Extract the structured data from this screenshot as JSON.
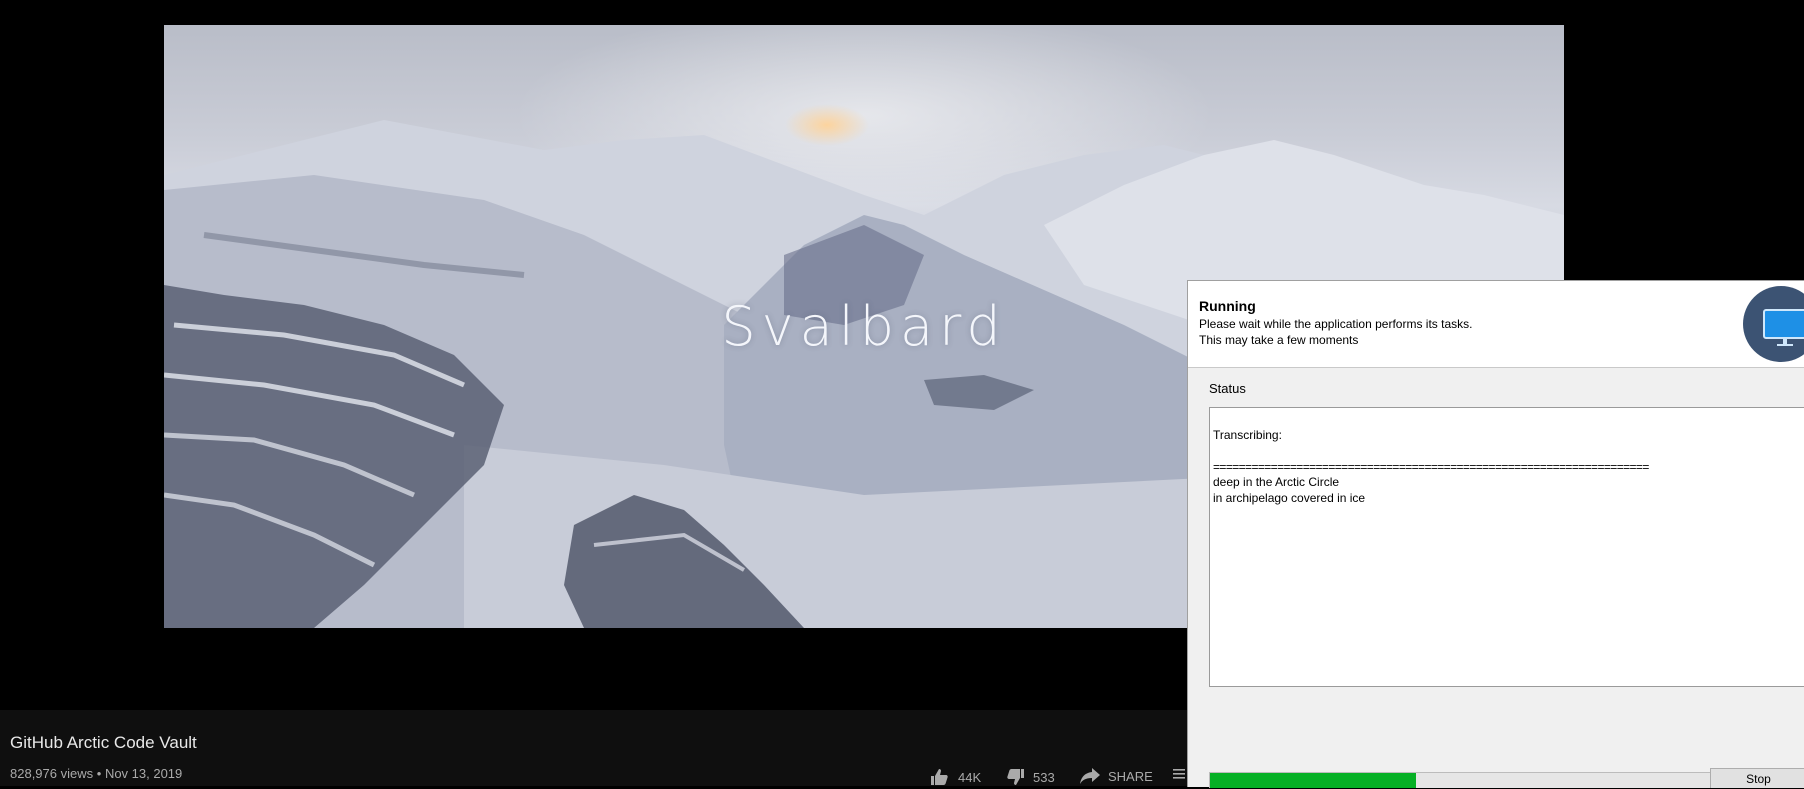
{
  "video": {
    "overlay_title": "Svalbard",
    "name": "GitHub Arctic Code Vault",
    "views": "828,976 views",
    "separator": "•",
    "date": "Nov 13, 2019",
    "likes": "44K",
    "dislikes": "533",
    "share_label": "SHARE"
  },
  "dialog": {
    "heading": "Running",
    "subtitle_line1": "Please wait while the application performs its tasks.",
    "subtitle_line2": "This may take a few moments",
    "status_label": "Status",
    "status_lines": [
      "Transcribing:",
      "====================================================================",
      "deep in the Arctic Circle",
      "in archipelago covered in ice"
    ],
    "progress_fraction": 0.41,
    "stop_label": "Stop"
  },
  "colors": {
    "progress": "#06b025",
    "info_bar_bg": "#0f0f0f",
    "dialog_icon_bg": "#3c5373",
    "monitor_icon": "#1e90e6"
  }
}
